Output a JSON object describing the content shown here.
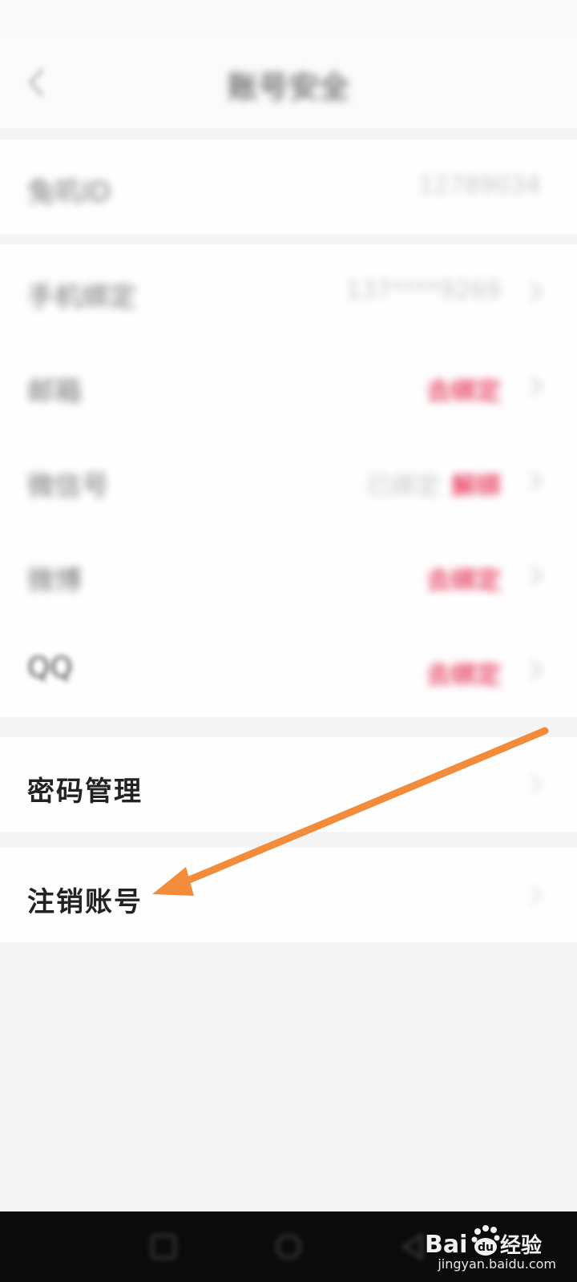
{
  "status_bar": {
    "left": "",
    "right": ""
  },
  "header": {
    "title": "账号安全"
  },
  "rows_top": [
    {
      "label": "兔叽ID",
      "value": "12789034"
    }
  ],
  "rows_bind": [
    {
      "label": "手机绑定",
      "value": "137****9269"
    },
    {
      "label": "邮箱",
      "status": "去绑定"
    },
    {
      "label": "微信号",
      "status_gray": "已绑定",
      "status": "解绑"
    },
    {
      "label": "微博",
      "status": "去绑定"
    },
    {
      "label": "QQ",
      "status": "去绑定"
    }
  ],
  "password": {
    "label": "密码管理"
  },
  "deregister": {
    "label": "注销账号"
  },
  "watermark": {
    "brand": "Bai",
    "brand2": "du",
    "suffix": "经验",
    "url": "jingyan.baidu.com"
  },
  "colors": {
    "accent_red": "#e84a6a",
    "arrow": "#f28c3a"
  }
}
